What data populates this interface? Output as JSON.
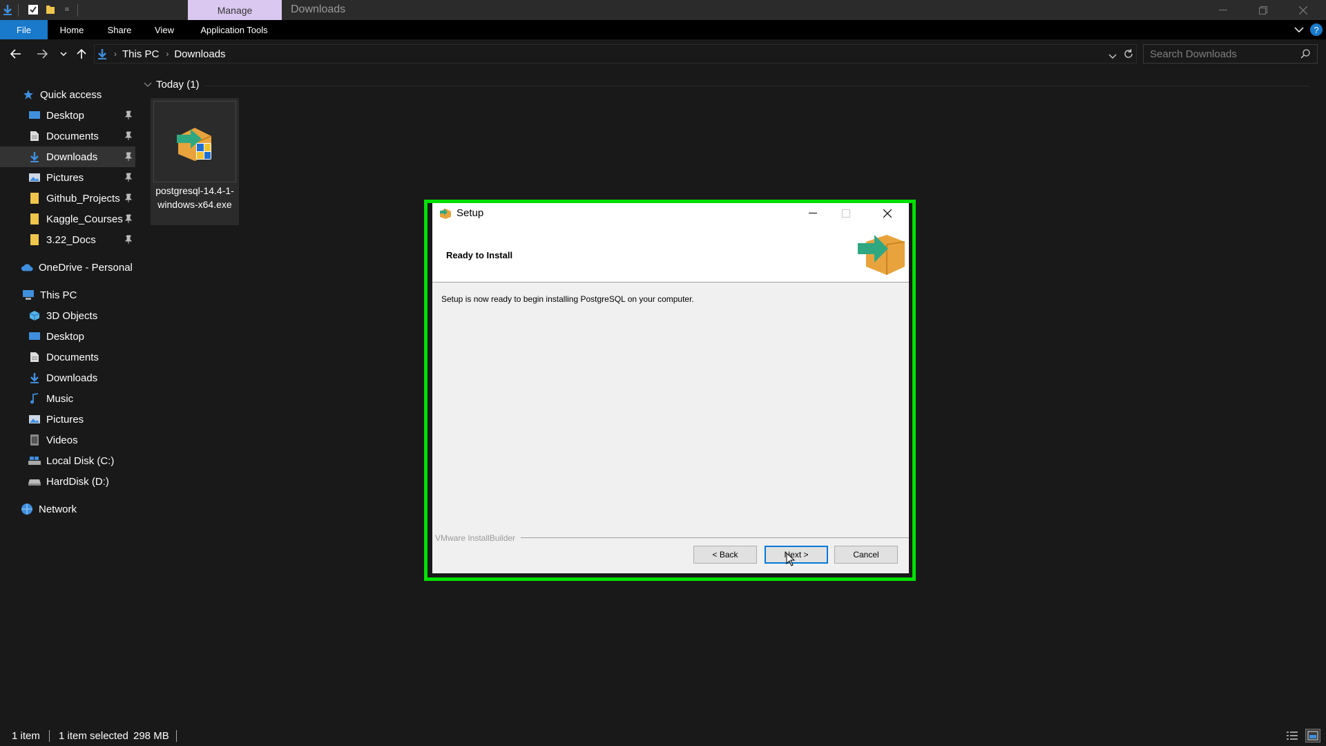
{
  "titlebar": {
    "manage_tab": "Manage",
    "window_title": "Downloads",
    "qa_dropdown": "="
  },
  "ribbon": {
    "tabs": [
      "File",
      "Home",
      "Share",
      "View",
      "Application Tools"
    ]
  },
  "address": {
    "crumbs": [
      "This PC",
      "Downloads"
    ],
    "search_placeholder": "Search Downloads"
  },
  "sidebar": {
    "quick_access": "Quick access",
    "quick_items": [
      "Desktop",
      "Documents",
      "Downloads",
      "Pictures",
      "Github_Projects",
      "Kaggle_Courses",
      "3.22_Docs"
    ],
    "onedrive": "OneDrive - Personal",
    "this_pc": "This PC",
    "pc_items": [
      "3D Objects",
      "Desktop",
      "Documents",
      "Downloads",
      "Music",
      "Pictures",
      "Videos",
      "Local Disk (C:)",
      "HardDisk (D:)"
    ],
    "network": "Network"
  },
  "content": {
    "group_header": "Today (1)",
    "file_name": "postgresql-14.4-1-windows-x64.exe"
  },
  "dialog": {
    "title": "Setup",
    "heading": "Ready to Install",
    "body": "Setup is now ready to begin installing PostgreSQL on your computer.",
    "brand": "VMware InstallBuilder",
    "back_label": "< Back",
    "next_label": "Next >",
    "cancel_label": "Cancel"
  },
  "status": {
    "item_count": "1 item",
    "selected": "1 item selected",
    "size": "298 MB"
  },
  "colors": {
    "accent": "#1979ca",
    "manage_tab": "#dac8f0",
    "highlight_outline": "#00e000",
    "folder": "#f0c54c"
  }
}
